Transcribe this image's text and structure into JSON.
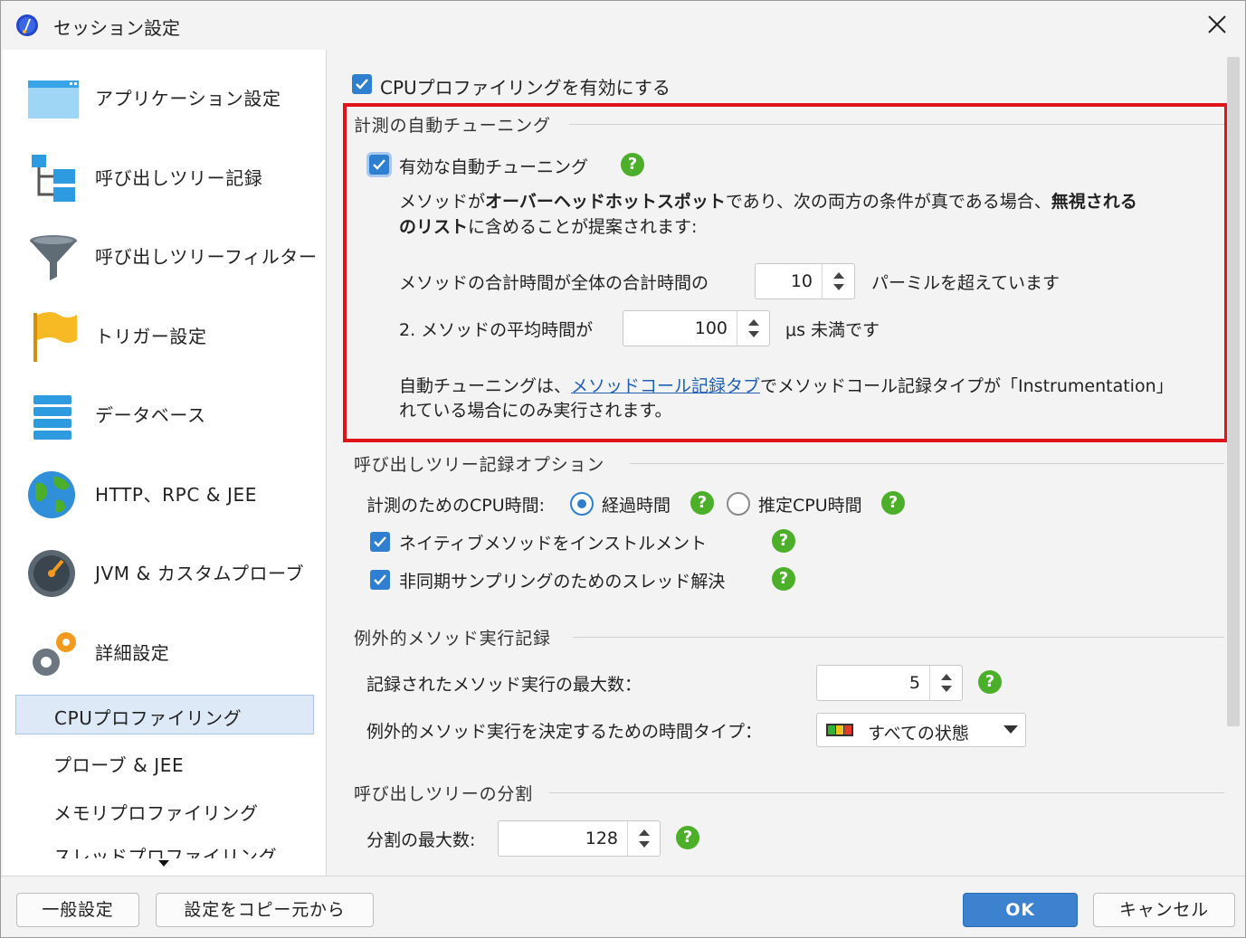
{
  "window": {
    "title": "セッション設定"
  },
  "sidebar": {
    "items": [
      {
        "label": "アプリケーション設定",
        "icon": "application-window-icon"
      },
      {
        "label": "呼び出しツリー記録",
        "icon": "call-tree-icon"
      },
      {
        "label": "呼び出しツリーフィルター",
        "icon": "funnel-icon"
      },
      {
        "label": "トリガー設定",
        "icon": "flag-icon"
      },
      {
        "label": "データベース",
        "icon": "database-icon"
      },
      {
        "label": "HTTP、RPC & JEE",
        "icon": "globe-icon"
      },
      {
        "label": "JVM & カスタムプローブ",
        "icon": "gauge-icon"
      },
      {
        "label": "詳細設定",
        "icon": "gears-icon"
      }
    ],
    "subitems": [
      {
        "label": "CPUプロファイリング",
        "selected": true
      },
      {
        "label": "プローブ & JEE"
      },
      {
        "label": "メモリプロファイリング"
      },
      {
        "label": "スレッドプロファイリング"
      }
    ]
  },
  "content": {
    "enable_cpu": {
      "label": "CPUプロファイリングを有効にする",
      "checked": true
    },
    "autotune": {
      "title": "計測の自動チューニング",
      "enable_label": "有効な自動チューニング",
      "desc_line1_a": "メソッドが",
      "desc_line1_b": "オーバーヘッドホットスポット",
      "desc_line1_c": "であり、次の両方の条件が真である場合、",
      "desc_line1_d": "無視される",
      "desc_line2_a": "のリスト",
      "desc_line2_b": "に含めることが提案されます:",
      "cond1_label": "メソッドの合計時間が全体の合計時間の",
      "cond1_value": "10",
      "cond1_suffix": "パーミルを超えています",
      "cond2_label": "2. メソッドの平均時間が",
      "cond2_value": "100",
      "cond2_suffix": "μs 未満です",
      "note_a": "自動チューニングは、",
      "note_link": "メソッドコール記録タブ",
      "note_b": "でメソッドコール記録タイプが「Instrumentation」",
      "note_line2": "れている場合にのみ実行されます。"
    },
    "calltree": {
      "title": "呼び出しツリー記録オプション",
      "cpu_time_label": "計測のためのCPU時間:",
      "radio_elapsed": "経過時間",
      "radio_estimated": "推定CPU時間",
      "selected_radio": "経過時間",
      "native_label": "ネイティブメソッドをインストルメント",
      "thread_label": "非同期サンプリングのためのスレッド解決"
    },
    "exceptional": {
      "title": "例外的メソッド実行記録",
      "max_label": "記録されたメソッド実行の最大数：",
      "max_value": "5",
      "timetype_label": "例外的メソッド実行を決定するための時間タイプ：",
      "timetype_value": "すべての状態"
    },
    "split": {
      "title": "呼び出しツリーの分割",
      "max_label": "分割の最大数:",
      "max_value": "128"
    }
  },
  "footer": {
    "general_button": "一般設定",
    "copy_button": "設定をコピー元から",
    "ok_button": "OK",
    "cancel_button": "キャンセル"
  },
  "colors": {
    "accent": "#2f7fd0",
    "highlight_box": "#e0131a",
    "help_icon": "#4caf2a",
    "ok_button": "#3d82cf"
  }
}
